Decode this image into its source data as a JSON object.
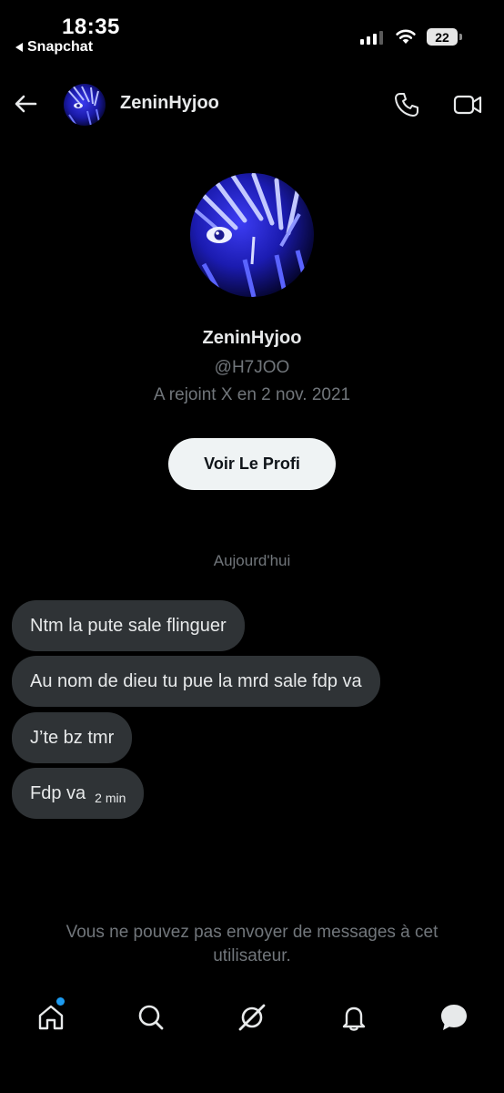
{
  "status_bar": {
    "time": "18:35",
    "back_app": "Snapchat",
    "battery": "22"
  },
  "header": {
    "name": "ZeninHyjoo",
    "icons": [
      "back-arrow-icon",
      "avatar",
      "phone-icon",
      "video-icon"
    ]
  },
  "profile": {
    "name": "ZeninHyjoo",
    "handle": "@H7JOO",
    "joined": "A rejoint X en 2 nov. 2021",
    "button_label": "Voir Le Profi"
  },
  "conversation": {
    "date_label": "Aujourd'hui",
    "messages": [
      {
        "text": "Ntm la pute sale flinguer"
      },
      {
        "text": "Au nom de dieu tu pue la mrd sale fdp va"
      },
      {
        "text": "J’te bz tmr"
      },
      {
        "text": "Fdp va",
        "time": "2 min"
      }
    ],
    "blocked_note": "Vous ne pouvez pas envoyer de messages à cet utilisateur."
  },
  "tab_bar": {
    "items": [
      "home-icon",
      "search-icon",
      "grok-icon",
      "notifications-icon",
      "messages-icon"
    ],
    "has_new_indicator": true
  },
  "colors": {
    "background": "#000000",
    "bubble": "#2f3336",
    "muted_text": "#71767b",
    "accent": "#1d9bf0"
  }
}
